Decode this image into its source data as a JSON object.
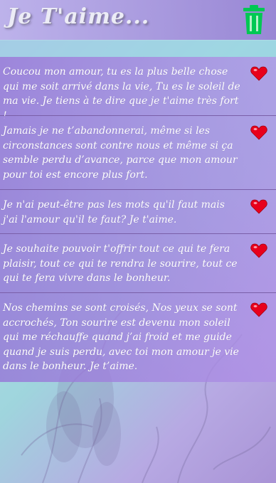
{
  "app": {
    "title": "Je T'aime..."
  },
  "header": {
    "delete_icon": "trash-icon",
    "accent": "#00c853"
  },
  "messages": [
    {
      "text": "Coucou mon amour, tu es la plus belle chose qui me soit arrivé dans la vie, Tu es le soleil de ma vie. Je tiens à te dire que je t'aime très fort !",
      "icon": "heart-icon"
    },
    {
      "text": "Jamais je ne t’abandonnerai, même si les circonstances sont contre nous et même si ça semble perdu d’avance, parce que mon amour pour toi est encore plus fort.",
      "icon": "heart-icon"
    },
    {
      "text": "Je n'ai peut-être pas les mots qu'il faut mais j'ai l'amour qu'il te faut? Je t'aime.",
      "icon": "heart-icon"
    },
    {
      "text": "Je souhaite pouvoir t'offrir tout ce qui te fera plaisir, tout ce qui te rendra le sourire, tout ce qui te fera vivre dans le bonheur.",
      "icon": "heart-icon"
    },
    {
      "text": "Nos chemins se sont croisés, Nos yeux se sont accrochés, Ton sourire est devenu mon soleil qui me réchauffe quand j’ai froid et me guide quand je suis perdu, avec toi mon amour je vie dans le bonheur. Je t’aime.",
      "icon": "heart-icon"
    }
  ],
  "colors": {
    "heart": "#e8001c",
    "item_bg": "#9a78d6",
    "divider": "#7a5fa8"
  }
}
